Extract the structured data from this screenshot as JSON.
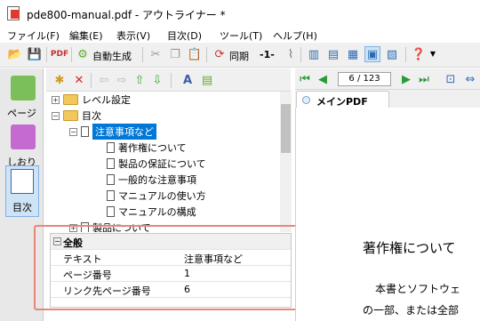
{
  "window": {
    "title": "pde800-manual.pdf - アウトライナー *"
  },
  "menu": [
    "ファイル(F)",
    "編集(E)",
    "表示(V)",
    "目次(D)",
    "ツール(T)",
    "ヘルプ(H)"
  ],
  "toolbar": {
    "auto_generate": "自動生成",
    "sync": "同期",
    "page_minus": "-1-"
  },
  "left_panel": {
    "items": [
      "ページ",
      "しおり",
      "目次"
    ]
  },
  "tree": {
    "items": [
      {
        "label": "レベル設定",
        "type": "folder",
        "expander": "+"
      },
      {
        "label": "目次",
        "type": "folder",
        "expander": "−"
      },
      {
        "label": "注意事項など",
        "type": "doc",
        "expander": "−",
        "selected": true
      },
      {
        "label": "著作権について",
        "type": "doc"
      },
      {
        "label": "製品の保証について",
        "type": "doc"
      },
      {
        "label": "一般的な注意事項",
        "type": "doc"
      },
      {
        "label": "マニュアルの使い方",
        "type": "doc"
      },
      {
        "label": "マニュアルの構成",
        "type": "doc"
      },
      {
        "label": "製品について",
        "type": "doc",
        "expander": "+"
      }
    ]
  },
  "properties": {
    "section": "全般",
    "rows": [
      {
        "key": "テキスト",
        "value": "注意事項など"
      },
      {
        "key": "ページ番号",
        "value": "1"
      },
      {
        "key": "リンク先ページ番号",
        "value": "6"
      }
    ]
  },
  "viewer": {
    "page_indicator": "6 / 123",
    "tab_label": "メインPDF"
  },
  "pdf": {
    "line1": "著作権について",
    "line2": "本書とソフトウェ",
    "line3": "の一部、または全部"
  },
  "colors": {
    "selection": "#0078d7",
    "highlight_border": "#e8867a",
    "folder": "#f2c75c"
  }
}
